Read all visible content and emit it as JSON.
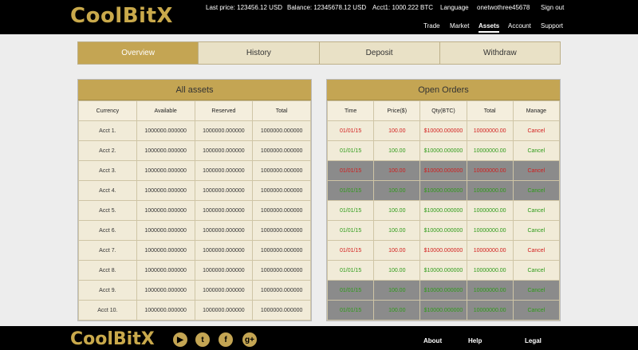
{
  "brand": {
    "name": "CoolBitX"
  },
  "header": {
    "last_price": "Last price: 123456.12 USD",
    "balance": "Balance: 12345678.12 USD",
    "acct1": "Acct1: 1000.222 BTC",
    "language": "Language",
    "username": "onetwothree45678",
    "signout": "Sign out"
  },
  "nav": {
    "trade": "Trade",
    "market": "Market",
    "assets": "Assets",
    "account": "Account",
    "support": "Support"
  },
  "tabs": {
    "overview": "Overview",
    "history": "History",
    "deposit": "Deposit",
    "withdraw": "Withdraw"
  },
  "assets": {
    "title": "All assets",
    "headers": [
      "Currency",
      "Available",
      "Reserved",
      "Total"
    ],
    "rows": [
      [
        "Acct 1.",
        "1000000.000000",
        "1000000.000000",
        "1000000.000000"
      ],
      [
        "Acct 2.",
        "1000000.000000",
        "1000000.000000",
        "1000000.000000"
      ],
      [
        "Acct 3.",
        "1000000.000000",
        "1000000.000000",
        "1000000.000000"
      ],
      [
        "Acct 4.",
        "1000000.000000",
        "1000000.000000",
        "1000000.000000"
      ],
      [
        "Acct 5.",
        "1000000.000000",
        "1000000.000000",
        "1000000.000000"
      ],
      [
        "Acct 6.",
        "1000000.000000",
        "1000000.000000",
        "1000000.000000"
      ],
      [
        "Acct 7.",
        "1000000.000000",
        "1000000.000000",
        "1000000.000000"
      ],
      [
        "Acct 8.",
        "1000000.000000",
        "1000000.000000",
        "1000000.000000"
      ],
      [
        "Acct 9.",
        "1000000.000000",
        "1000000.000000",
        "1000000.000000"
      ],
      [
        "Acct 10.",
        "1000000.000000",
        "1000000.000000",
        "1000000.000000"
      ]
    ]
  },
  "orders": {
    "title": "Open Orders",
    "headers": [
      "Time",
      "Price($)",
      "Qty(BTC)",
      "Total",
      "Manage"
    ],
    "rows": [
      {
        "time": "01/01/15",
        "price": "100.00",
        "qty": "$10000.000000",
        "total": "10000000.00",
        "manage": "Cancel",
        "color": "red",
        "dark": false
      },
      {
        "time": "01/01/15",
        "price": "100.00",
        "qty": "$10000.000000",
        "total": "10000000.00",
        "manage": "Cancel",
        "color": "green",
        "dark": false
      },
      {
        "time": "01/01/15",
        "price": "100.00",
        "qty": "$10000.000000",
        "total": "10000000.00",
        "manage": "Cancel",
        "color": "red",
        "dark": true
      },
      {
        "time": "01/01/15",
        "price": "100.00",
        "qty": "$10000.000000",
        "total": "10000000.00",
        "manage": "Cancel",
        "color": "green",
        "dark": true
      },
      {
        "time": "01/01/15",
        "price": "100.00",
        "qty": "$10000.000000",
        "total": "10000000.00",
        "manage": "Cancel",
        "color": "green",
        "dark": false
      },
      {
        "time": "01/01/15",
        "price": "100.00",
        "qty": "$10000.000000",
        "total": "10000000.00",
        "manage": "Cancel",
        "color": "green",
        "dark": false
      },
      {
        "time": "01/01/15",
        "price": "100.00",
        "qty": "$10000.000000",
        "total": "10000000.00",
        "manage": "Cancel",
        "color": "red",
        "dark": false
      },
      {
        "time": "01/01/15",
        "price": "100.00",
        "qty": "$10000.000000",
        "total": "10000000.00",
        "manage": "Cancel",
        "color": "green",
        "dark": false
      },
      {
        "time": "01/01/15",
        "price": "100.00",
        "qty": "$10000.000000",
        "total": "10000000.00",
        "manage": "Cancel",
        "color": "green",
        "dark": true
      },
      {
        "time": "01/01/15",
        "price": "100.00",
        "qty": "$10000.000000",
        "total": "10000000.00",
        "manage": "Cancel",
        "color": "green",
        "dark": true
      }
    ]
  },
  "footer": {
    "social": [
      {
        "icon": "youtube-icon",
        "glyph": "▶"
      },
      {
        "icon": "twitter-icon",
        "glyph": "t"
      },
      {
        "icon": "facebook-icon",
        "glyph": "f"
      },
      {
        "icon": "google-plus-icon",
        "glyph": "g+"
      }
    ],
    "about": "About",
    "help": "Help",
    "legal": "Legal"
  },
  "colors": {
    "gold": "#c4a553",
    "cream": "#f1ebd8",
    "dark_row": "#8b8b8b",
    "sell": "#d21c1c",
    "buy": "#2e9b19"
  }
}
